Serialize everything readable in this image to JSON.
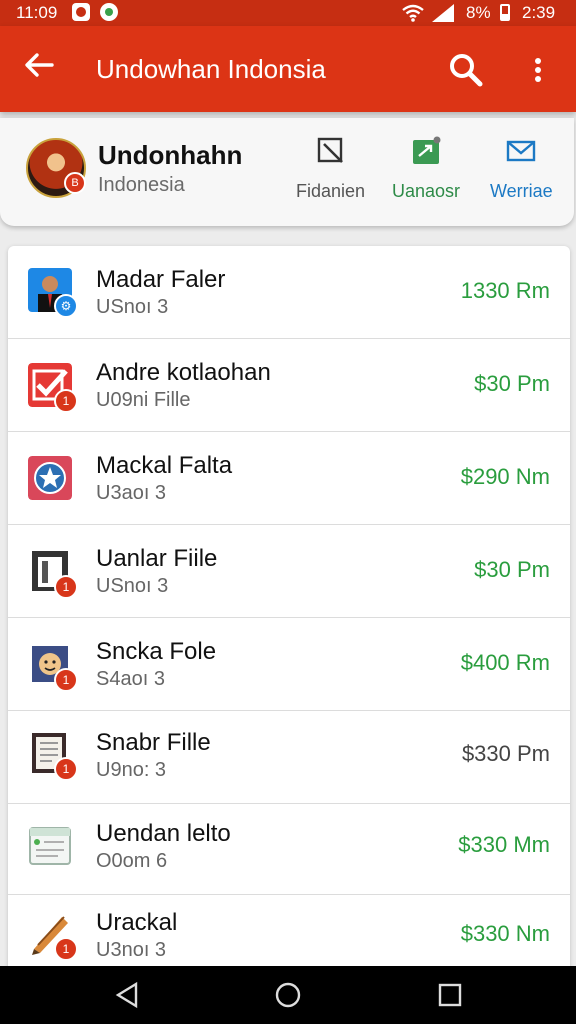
{
  "status": {
    "time_left": "11:09",
    "battery_text": "8%",
    "time_right": "2:39",
    "bar_color": "#c62e12"
  },
  "appbar": {
    "title": "Undowhan Indonsia",
    "color": "#dc3415",
    "icons": [
      "back-arrow-icon",
      "search-icon",
      "more-vert-icon"
    ]
  },
  "profile": {
    "name": "Undonhahn",
    "subtitle": "Indonesia",
    "actions": [
      {
        "label": "Fidanien",
        "icon": "edit-icon",
        "color": "#555555"
      },
      {
        "label": "Uanaosr",
        "icon": "share-icon",
        "color": "#2e8b48"
      },
      {
        "label": "Werriae",
        "icon": "mail-icon",
        "color": "#1c79c4"
      }
    ]
  },
  "files": [
    {
      "name": "Madar Faler",
      "sub": "USnoı 3",
      "amount": "1330 Rm",
      "amount_color": "green",
      "icon": "portrait-icon"
    },
    {
      "name": "Andre kotlaohan",
      "sub": "U09ni Fille",
      "amount": "$30 Pm",
      "amount_color": "green",
      "icon": "checkmark-icon"
    },
    {
      "name": "Mackal Falta",
      "sub": "U3aoı 3",
      "amount": "$290 Nm",
      "amount_color": "green",
      "icon": "star-badge-icon"
    },
    {
      "name": "Uanlar Fiile",
      "sub": "USnoı 3",
      "amount": "$30 Pm",
      "amount_color": "green",
      "icon": "door-icon"
    },
    {
      "name": "Sncka Fole",
      "sub": "S4aoı 3",
      "amount": "$400 Rm",
      "amount_color": "green",
      "icon": "face-icon"
    },
    {
      "name": "Snabr Fille",
      "sub": "U9no: 3",
      "amount": "$330 Pm",
      "amount_color": "gray",
      "icon": "document-icon"
    },
    {
      "name": "Uendan lelto",
      "sub": "O0om 6",
      "amount": "$330 Mm",
      "amount_color": "green",
      "icon": "window-icon"
    },
    {
      "name": "Urackal",
      "sub": "U3noı 3",
      "amount": "$330 Nm",
      "amount_color": "green",
      "icon": "pencil-icon"
    }
  ],
  "badge_text": "1"
}
